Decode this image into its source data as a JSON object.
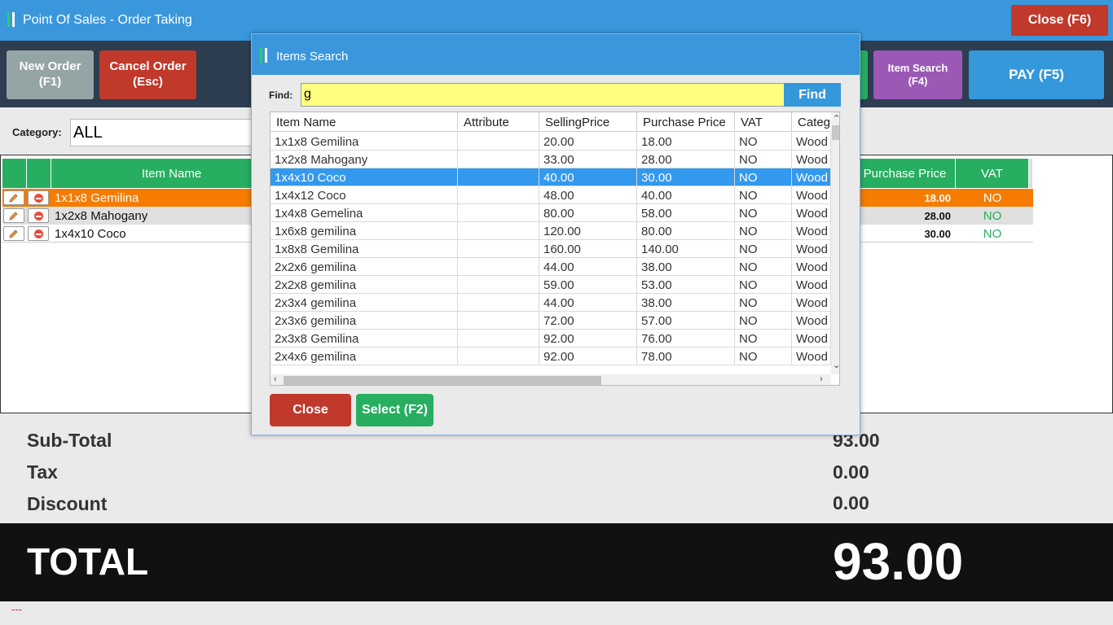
{
  "window": {
    "title": "Point Of Sales - Order Taking",
    "close_label": "Close (F6)"
  },
  "toolbar": {
    "new_order": {
      "line1": "New Order",
      "line2": "(F1)"
    },
    "cancel_order": {
      "line1": "Cancel Order",
      "line2": "(Esc)"
    },
    "item_search": {
      "line1": "Item Search",
      "line2": "(F4)"
    },
    "pay": "PAY (F5)"
  },
  "category": {
    "label": "Category:",
    "value": "ALL"
  },
  "order": {
    "columns": [
      "Item Name",
      "Purchase Price",
      "VAT"
    ],
    "rows": [
      {
        "name": "1x1x8 Gemilina",
        "purchase_price": "18.00",
        "vat": "NO",
        "highlight": "orange"
      },
      {
        "name": "1x2x8 Mahogany",
        "purchase_price": "28.00",
        "vat": "NO",
        "highlight": "gray"
      },
      {
        "name": "1x4x10 Coco",
        "purchase_price": "30.00",
        "vat": "NO",
        "highlight": "none"
      }
    ]
  },
  "totals": {
    "subtotal_label": "Sub-Total",
    "subtotal": "93.00",
    "tax_label": "Tax",
    "tax": "0.00",
    "discount_label": "Discount",
    "discount": "0.00",
    "total_label": "TOTAL",
    "total": "93.00"
  },
  "status_text": "---",
  "dialog": {
    "title": "Items Search",
    "find_label": "Find:",
    "find_value": "g",
    "find_button": "Find",
    "columns": [
      "Item Name",
      "Attribute",
      "SellingPrice",
      "Purchase Price",
      "VAT",
      "Categ"
    ],
    "rows": [
      {
        "name": "1x1x8 Gemilina",
        "attribute": "",
        "selling": "20.00",
        "purchase": "18.00",
        "vat": "NO",
        "category": "Wood"
      },
      {
        "name": "1x2x8 Mahogany",
        "attribute": "",
        "selling": "33.00",
        "purchase": "28.00",
        "vat": "NO",
        "category": "Wood"
      },
      {
        "name": "1x4x10 Coco",
        "attribute": "",
        "selling": "40.00",
        "purchase": "30.00",
        "vat": "NO",
        "category": "Wood"
      },
      {
        "name": "1x4x12 Coco",
        "attribute": "",
        "selling": "48.00",
        "purchase": "40.00",
        "vat": "NO",
        "category": "Wood"
      },
      {
        "name": "1x4x8 Gemelina",
        "attribute": "",
        "selling": "80.00",
        "purchase": "58.00",
        "vat": "NO",
        "category": "Wood"
      },
      {
        "name": "1x6x8 gemilina",
        "attribute": "",
        "selling": "120.00",
        "purchase": "80.00",
        "vat": "NO",
        "category": "Wood"
      },
      {
        "name": "1x8x8 Gemilina",
        "attribute": "",
        "selling": "160.00",
        "purchase": "140.00",
        "vat": "NO",
        "category": "Wood"
      },
      {
        "name": "2x2x6 gemilina",
        "attribute": "",
        "selling": "44.00",
        "purchase": "38.00",
        "vat": "NO",
        "category": "Wood"
      },
      {
        "name": "2x2x8 gemilina",
        "attribute": "",
        "selling": "59.00",
        "purchase": "53.00",
        "vat": "NO",
        "category": "Wood"
      },
      {
        "name": "2x3x4 gemilina",
        "attribute": "",
        "selling": "44.00",
        "purchase": "38.00",
        "vat": "NO",
        "category": "Wood"
      },
      {
        "name": "2x3x6 gemilina",
        "attribute": "",
        "selling": "72.00",
        "purchase": "57.00",
        "vat": "NO",
        "category": "Wood"
      },
      {
        "name": "2x3x8 Gemilina",
        "attribute": "",
        "selling": "92.00",
        "purchase": "76.00",
        "vat": "NO",
        "category": "Wood"
      },
      {
        "name": "2x4x6 gemilina",
        "attribute": "",
        "selling": "92.00",
        "purchase": "78.00",
        "vat": "NO",
        "category": "Wood"
      }
    ],
    "selected_index": 2,
    "close_button": "Close",
    "select_button": "Select (F2)"
  },
  "colors": {
    "accent": "#3a97dc",
    "green": "#27ae60",
    "red": "#c0392b",
    "purple": "#9b59b6",
    "highlight_row": "#f57c00"
  }
}
